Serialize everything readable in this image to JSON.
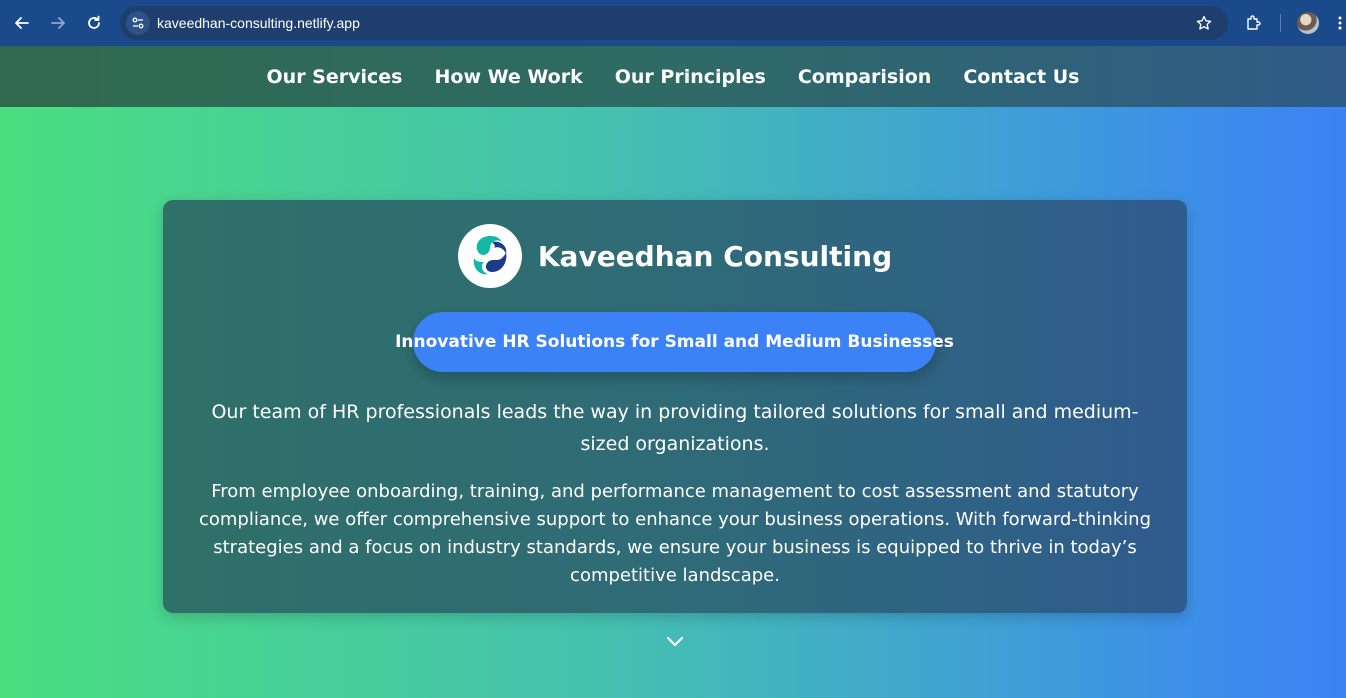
{
  "browser": {
    "url": "kaveedhan-consulting.netlify.app",
    "icons": [
      "back-arrow-icon",
      "forward-arrow-icon",
      "reload-icon",
      "site-settings-icon",
      "bookmark-star-icon",
      "extensions-icon",
      "profile-avatar",
      "more-menu-icon"
    ]
  },
  "nav": {
    "items": [
      {
        "label": "Our Services"
      },
      {
        "label": "How We Work"
      },
      {
        "label": "Our Principles"
      },
      {
        "label": "Comparision"
      },
      {
        "label": "Contact Us"
      }
    ]
  },
  "hero": {
    "brand_name": "Kaveedhan Consulting",
    "tagline": "Innovative HR Solutions for Small and Medium Businesses",
    "paragraph1": "Our team of HR professionals leads the way in providing tailored solutions for small and medium-sized organizations.",
    "paragraph2": "From employee onboarding, training, and performance management to cost assessment and statutory compliance, we offer comprehensive support to enhance your business operations. With forward-thinking strategies and a focus on industry standards, we ensure your business is equipped to thrive in today’s competitive landscape."
  },
  "colors": {
    "accent": "#3b82f6",
    "gradient_start": "#4ade80",
    "gradient_end": "#3b82f6",
    "logo_teal": "#14b8a6",
    "logo_navy": "#1e3a8a"
  }
}
